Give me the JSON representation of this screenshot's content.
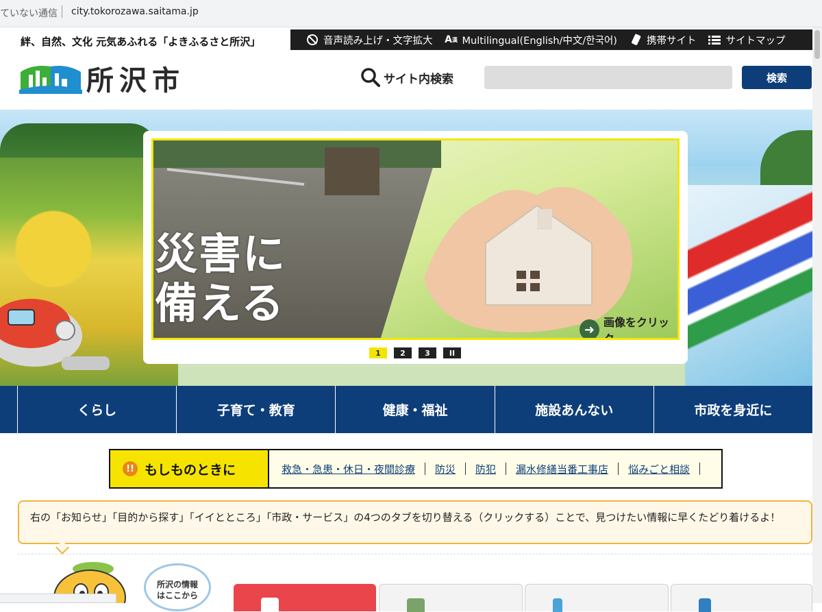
{
  "browser": {
    "security_text": "ていない通信",
    "url": "city.tokorozawa.saitama.jp"
  },
  "header": {
    "tagline": "絆、自然、文化 元気あふれる「よきふるさと所沢」",
    "logo_text": "所沢市",
    "utility_links": [
      {
        "label": "音声読み上げ・文字拡大",
        "icon": "speech-icon"
      },
      {
        "label": "Multilingual(English/中文/한국어)",
        "icon": "translate-icon"
      },
      {
        "label": "携帯サイト",
        "icon": "mobile-icon"
      },
      {
        "label": "サイトマップ",
        "icon": "list-icon"
      }
    ],
    "search": {
      "label": "サイト内検索",
      "placeholder": "",
      "button_label": "検索"
    }
  },
  "hero": {
    "slide_title_line1": "災害に",
    "slide_title_line2": "備える",
    "click_hint": "画像をクリック",
    "pager": [
      "1",
      "2",
      "3",
      "II"
    ],
    "active_page": 1
  },
  "main_nav": [
    "くらし",
    "子育て・教育",
    "健康・福祉",
    "施設あんない",
    "市政を身近に"
  ],
  "emergency": {
    "heading": "もしものときに",
    "badge": "!!",
    "links": [
      "救急・急患・休日・夜間診療",
      "防災",
      "防犯",
      "漏水修繕当番工事店",
      "悩みごと相談"
    ]
  },
  "info_message": "右の「お知らせ」「目的から探す」「イイとところ」「市政・サービス」の4つのタブを切り替える（クリックする）ことで、見つけたい情報に早くたどり着けるよ！",
  "mascot_bubble": [
    "所沢の情報",
    "はここから"
  ],
  "colors": {
    "navy": "#0d3e79",
    "yellow": "#f6e400",
    "tab_red": "#e9454a"
  }
}
